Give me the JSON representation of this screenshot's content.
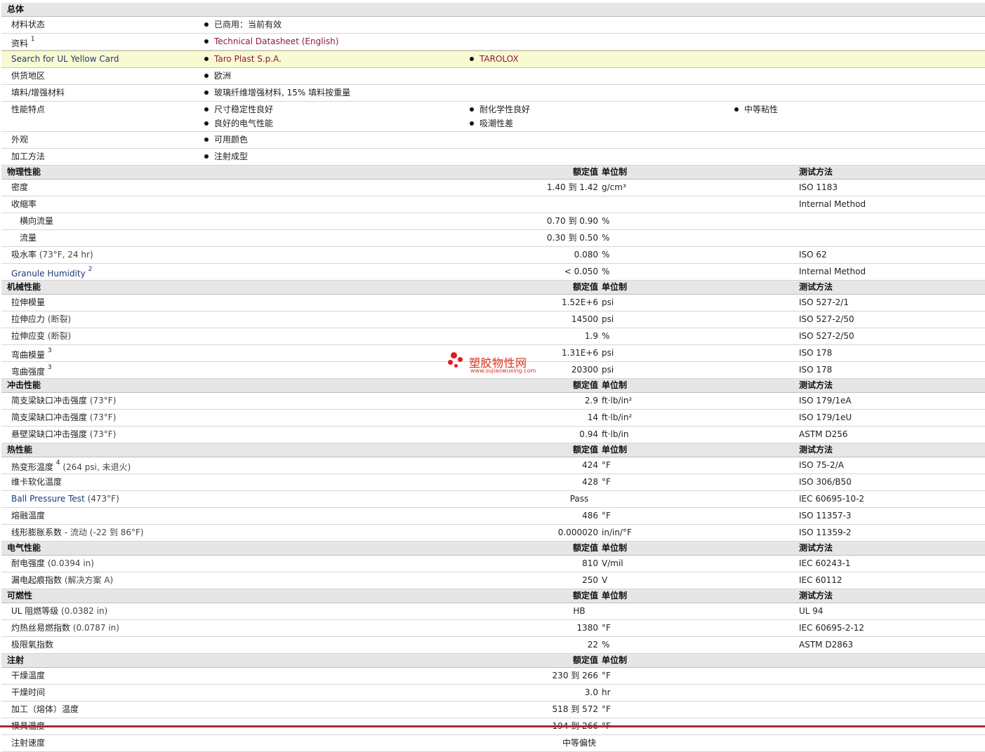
{
  "general": {
    "title": "总体",
    "status": {
      "label": "材料状态",
      "value": "已商用：当前有效"
    },
    "docs": {
      "label": "资料",
      "sup": "1",
      "value": "Technical Datasheet (English)"
    },
    "ulcard": {
      "label": "Search for UL Yellow Card",
      "items": [
        "Taro Plast S.p.A.",
        "TAROLOX"
      ]
    },
    "region": {
      "label": "供货地区",
      "value": "欧洲"
    },
    "filler": {
      "label": "填料/增强材料",
      "value": "玻璃纤维增强材料, 15% 填料按重量"
    },
    "features": {
      "label": "性能特点",
      "items": [
        "尺寸稳定性良好",
        "耐化学性良好",
        "中等粘性",
        "良好的电气性能",
        "吸潮性差"
      ]
    },
    "appearance": {
      "label": "外观",
      "value": "可用颜色"
    },
    "processing": {
      "label": "加工方法",
      "value": "注射成型"
    }
  },
  "headers": {
    "nominal": "额定值",
    "unit": "单位制",
    "test": "测试方法"
  },
  "physical": {
    "title": "物理性能",
    "rows": [
      {
        "label": "密度",
        "value": "1.40 到  1.42",
        "unit": "g/cm³",
        "test": "ISO 1183"
      },
      {
        "label": "收缩率",
        "value": "",
        "unit": "",
        "test": "Internal Method"
      },
      {
        "label": "横向流量",
        "value": "0.70 到  0.90",
        "unit": "%",
        "test": ""
      },
      {
        "label": "流量",
        "value": "0.30 到  0.50",
        "unit": "%",
        "test": ""
      },
      {
        "label": "吸水率",
        "cond": "(73°F, 24 hr)",
        "value": "0.080",
        "unit": "%",
        "test": "ISO 62"
      },
      {
        "label": "Granule Humidity",
        "sup": "2",
        "value": "< 0.050",
        "unit": "%",
        "test": "Internal Method"
      }
    ]
  },
  "mechanical": {
    "title": "机械性能",
    "rows": [
      {
        "label": "拉伸模量",
        "value": "1.52E+6",
        "unit": "psi",
        "test": "ISO 527-2/1"
      },
      {
        "label": "拉伸应力",
        "cond": "(断裂)",
        "value": "14500",
        "unit": "psi",
        "test": "ISO 527-2/50"
      },
      {
        "label": "拉伸应变",
        "cond": "(断裂)",
        "value": "1.9",
        "unit": "%",
        "test": "ISO 527-2/50"
      },
      {
        "label": "弯曲模量",
        "sup": "3",
        "value": "1.31E+6",
        "unit": "psi",
        "test": "ISO 178"
      },
      {
        "label": "弯曲强度",
        "sup": "3",
        "value": "20300",
        "unit": "psi",
        "test": "ISO 178"
      }
    ]
  },
  "impact": {
    "title": "冲击性能",
    "rows": [
      {
        "label": "简支梁缺口冲击强度",
        "cond": "(73°F)",
        "value": "2.9",
        "unit": "ft·lb/in²",
        "test": "ISO 179/1eA"
      },
      {
        "label": "简支梁缺口冲击强度",
        "cond": "(73°F)",
        "value": "14",
        "unit": "ft·lb/in²",
        "test": "ISO 179/1eU"
      },
      {
        "label": "悬壁梁缺口冲击强度",
        "cond": "(73°F)",
        "value": "0.94",
        "unit": "ft·lb/in",
        "test": "ASTM D256"
      }
    ]
  },
  "thermal": {
    "title": "热性能",
    "rows": [
      {
        "label": "热变形温度",
        "sup": "4",
        "cond": "(264 psi, 未退火)",
        "value": "424",
        "unit": "°F",
        "test": "ISO 75-2/A"
      },
      {
        "label": "维卡软化温度",
        "value": "428",
        "unit": "°F",
        "test": "ISO 306/B50"
      },
      {
        "label": "Ball Pressure Test",
        "cond": "(473°F)",
        "value": "Pass",
        "unit": "",
        "test": "IEC 60695-10-2"
      },
      {
        "label": "熔融温度",
        "value": "486",
        "unit": "°F",
        "test": "ISO 11357-3"
      },
      {
        "label": "线形膨胀系数",
        "cond": "- 流动  (-22 到  86°F)",
        "value": "0.000020",
        "unit": "in/in/°F",
        "test": "ISO 11359-2"
      }
    ]
  },
  "electrical": {
    "title": "电气性能",
    "rows": [
      {
        "label": "耐电强度",
        "cond": "(0.0394 in)",
        "value": "810",
        "unit": "V/mil",
        "test": "IEC 60243-1"
      },
      {
        "label": "漏电起痕指数",
        "cond": "(解决方案  A)",
        "value": "250",
        "unit": "V",
        "test": "IEC 60112"
      }
    ]
  },
  "flammability": {
    "title": "可燃性",
    "rows": [
      {
        "label": "UL 阻燃等级",
        "cond": "(0.0382 in)",
        "value": "HB",
        "unit": "",
        "test": "UL 94"
      },
      {
        "label": "灼热丝易燃指数",
        "cond": "(0.0787 in)",
        "value": "1380",
        "unit": "°F",
        "test": "IEC 60695-2-12"
      },
      {
        "label": "极限氧指数",
        "value": "22",
        "unit": "%",
        "test": "ASTM D2863"
      }
    ]
  },
  "injection": {
    "title": "注射",
    "rows": [
      {
        "label": "干燥温度",
        "value": "230 到  266",
        "unit": "°F"
      },
      {
        "label": "干燥时间",
        "value": "3.0",
        "unit": "hr"
      },
      {
        "label": "加工（熔体）温度",
        "value": "518 到  572",
        "unit": "°F"
      },
      {
        "label": "模具温度",
        "value": "194 到  266",
        "unit": "°F"
      },
      {
        "label": "注射速度",
        "value": "中等偏快",
        "unit": ""
      }
    ]
  },
  "watermark": {
    "cn": "塑胶物性网",
    "en": "www.sujiaowuxing.com"
  },
  "colors": {
    "section_bg": "#e6e6e6",
    "highlight_bg": "#fafad2",
    "link": "#8a1a3a",
    "label_blue": "#1a3a7a",
    "bottom_bar": "#a8283a"
  }
}
